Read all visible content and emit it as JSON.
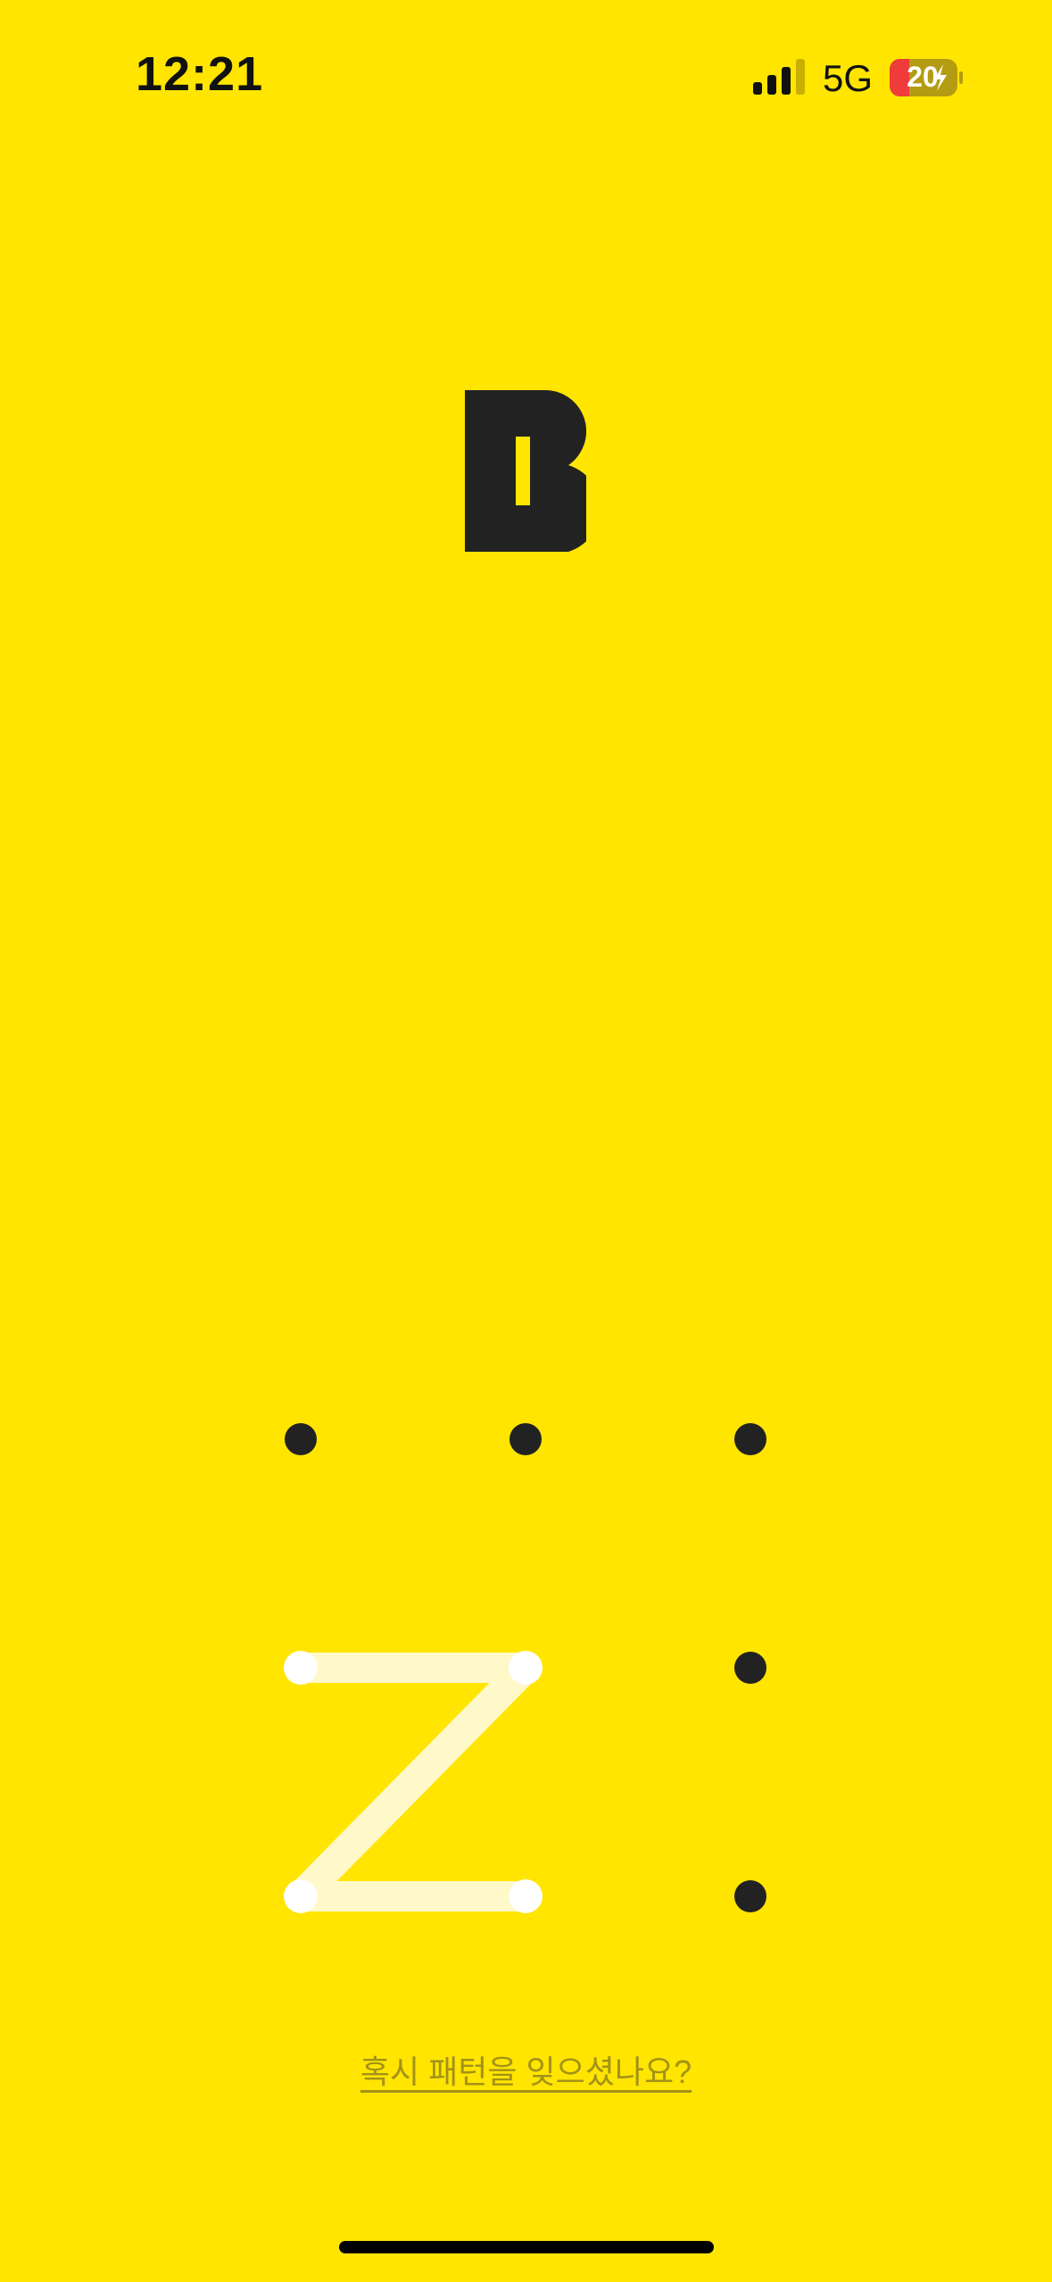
{
  "status_bar": {
    "time": "12:21",
    "network": "5G",
    "battery_level": "20",
    "signal_icon": "signal-bars-icon",
    "battery_icon": "battery-charging-icon"
  },
  "logo": {
    "icon": "bank-b-logo"
  },
  "pattern": {
    "selected_sequence": [
      1,
      2,
      3,
      4
    ],
    "dot_color": "#222222",
    "selected_color": "#FFFFFF",
    "line_color": "#FFF8C8"
  },
  "forgot_pattern_link": "혹시 패턴을 잊으셨나요?",
  "colors": {
    "background": "#FFE500",
    "link": "#A39217"
  }
}
